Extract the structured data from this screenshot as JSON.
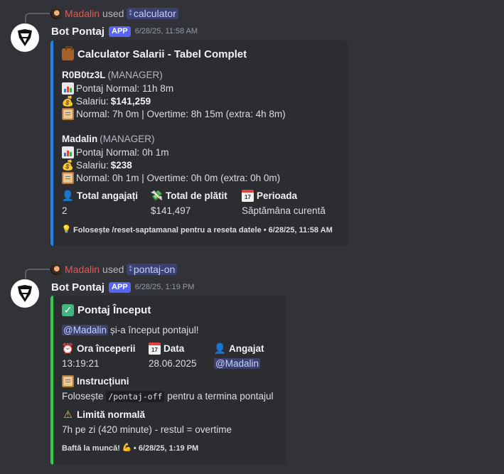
{
  "messages": [
    {
      "reply": {
        "user": "Madalin",
        "used": "used",
        "command": "calculator"
      },
      "bot": {
        "name": "Bot Pontaj",
        "tag": "APP",
        "timestamp": "6/28/25, 11:58 AM"
      },
      "embed": {
        "accent": "#1a86ed",
        "title": "Calculator Salarii - Tabel Complet",
        "employees": [
          {
            "name": "R0B0tz3L",
            "role": "(MANAGER)",
            "pontaj": "Pontaj Normal: 11h 8m",
            "salary_label": "Salariu: ",
            "salary_value": "$141,259",
            "breakdown": "Normal: 7h 0m | Overtime: 8h 15m (extra: 4h 8m)"
          },
          {
            "name": "Madalin",
            "role": "(MANAGER)",
            "pontaj": "Pontaj Normal: 0h 1m",
            "salary_label": "Salariu: ",
            "salary_value": "$238",
            "breakdown": "Normal: 0h 1m | Overtime: 0h 0m (extra: 0h 0m)"
          }
        ],
        "fields": [
          {
            "name": "Total angajați",
            "value": "2"
          },
          {
            "name": "Total de plătit",
            "value": "$141,497"
          },
          {
            "name": "Perioada",
            "value": "Săptămâna curentă"
          }
        ],
        "footer": "Folosește /reset-saptamanal pentru a reseta datele • 6/28/25, 11:58 AM"
      }
    },
    {
      "reply": {
        "user": "Madalin",
        "used": "used",
        "command": "pontaj-on"
      },
      "bot": {
        "name": "Bot Pontaj",
        "tag": "APP",
        "timestamp": "6/28/25, 1:19 PM"
      },
      "embed": {
        "accent": "#2ecc4a",
        "title": "Pontaj Început",
        "mention": "@Madalin",
        "description_rest": " și-a început pontajul!",
        "fields": [
          {
            "name": "Ora începerii",
            "value": "13:19:21"
          },
          {
            "name": "Data",
            "value": "28.06.2025"
          },
          {
            "name": "Angajat",
            "value": "@Madalin"
          }
        ],
        "instructions_name": "Instrucțiuni",
        "instructions_pre": "Folosește ",
        "instructions_code": "/pontaj-off",
        "instructions_post": " pentru a termina pontajul",
        "limit_name": "Limită normală",
        "limit_value": "7h pe zi (420 minute) - restul = overtime",
        "footer_text": "Baftă la muncă! ",
        "footer_time": " • 6/28/25, 1:19 PM"
      }
    }
  ]
}
